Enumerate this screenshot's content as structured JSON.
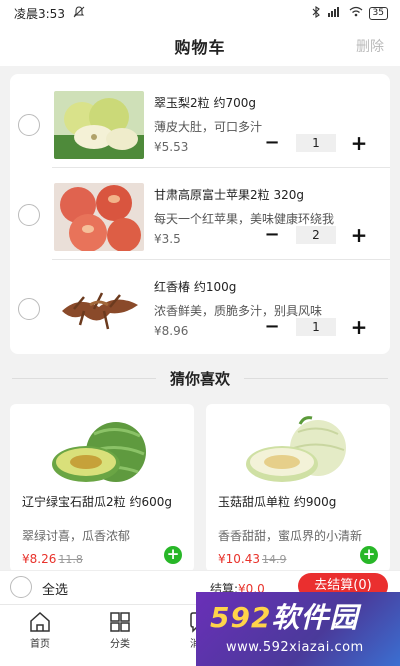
{
  "status_bar": {
    "time": "凌晨3:53",
    "battery": "35"
  },
  "nav": {
    "title": "购物车",
    "delete_label": "删除"
  },
  "cart_items": [
    {
      "name": "翠玉梨2粒 约700g",
      "desc": "薄皮大肚，可口多汁",
      "price": "¥5.53",
      "qty": "1",
      "minus": "−",
      "plus": "+"
    },
    {
      "name": "甘肃高原富士苹果2粒 320g",
      "desc": "每天一个红苹果，美味健康环绕我",
      "price": "¥3.5",
      "qty": "2",
      "minus": "−",
      "plus": "+"
    },
    {
      "name": "红香椿 约100g",
      "desc": "浓香鲜美，质脆多汁，别具风味",
      "price": "¥8.96",
      "qty": "1",
      "minus": "−",
      "plus": "+"
    }
  ],
  "guess_title": "猜你喜欢",
  "recommendations": [
    {
      "name": "辽宁绿宝石甜瓜2粒 约600g",
      "desc": "翠绿讨喜，瓜香浓郁",
      "price": "¥8.26",
      "old_price": "11.8",
      "add": "+"
    },
    {
      "name": "玉菇甜瓜单粒 约900g",
      "desc": "香香甜甜，蜜瓜界的小清新",
      "price": "¥10.43",
      "old_price": "14.9",
      "add": "+"
    }
  ],
  "checkout": {
    "select_all": "全选",
    "total_label": "结算:",
    "total_value": "¥0.0",
    "button": "去结算(0)"
  },
  "tabs": [
    {
      "label": "首页",
      "icon": "home-icon"
    },
    {
      "label": "分类",
      "icon": "category-icon"
    },
    {
      "label": "消息",
      "icon": "message-icon"
    },
    {
      "label": "我的",
      "icon": "profile-icon"
    }
  ],
  "watermark": {
    "brand_num": "592",
    "brand_text": "软件园",
    "url": "www.592xiazai.com"
  },
  "colors": {
    "accent_red": "#ea2f2f",
    "add_green": "#28b728"
  }
}
